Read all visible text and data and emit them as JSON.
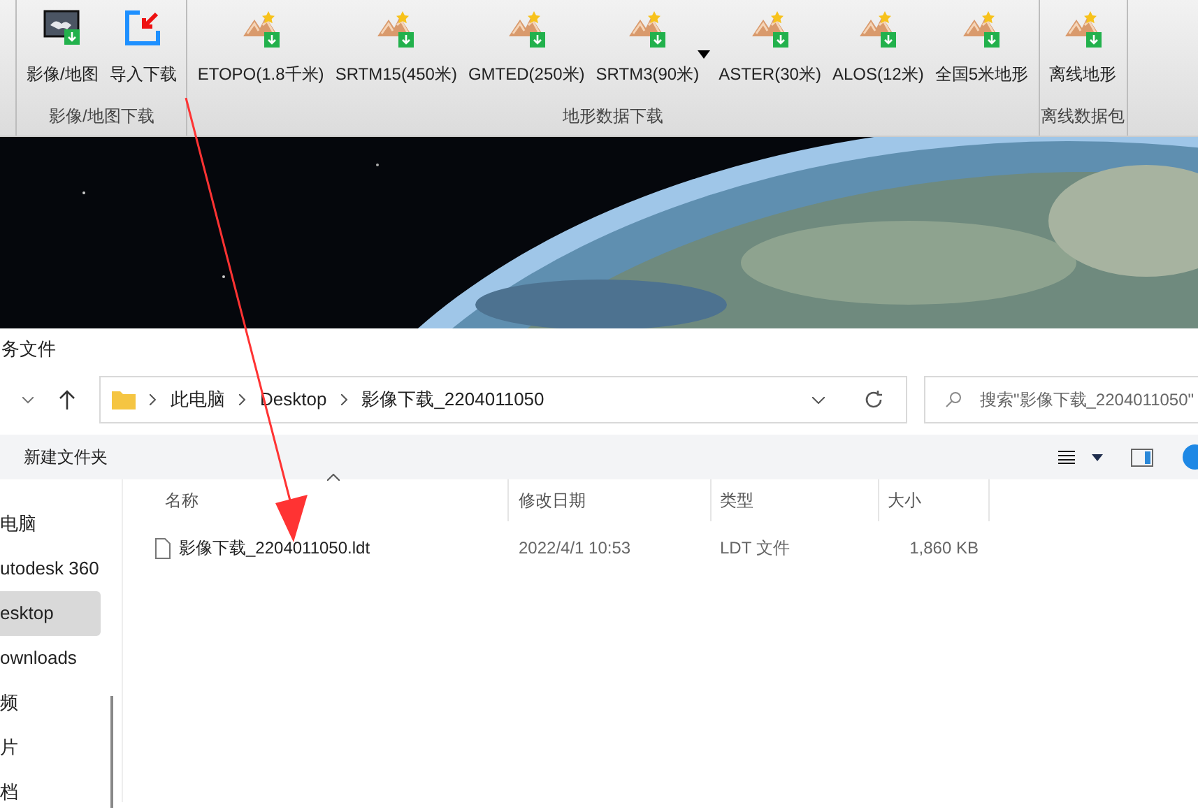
{
  "ribbon": {
    "groups": [
      {
        "label": "影像/地图下载",
        "buttons": [
          {
            "label": "影像/地图",
            "kind": "map"
          },
          {
            "label": "导入下载",
            "kind": "import"
          }
        ]
      },
      {
        "label": "地形数据下载",
        "buttons": [
          {
            "label": "ETOPO(1.8千米)",
            "kind": "terrain"
          },
          {
            "label": "SRTM15(450米)",
            "kind": "terrain"
          },
          {
            "label": "GMTED(250米)",
            "kind": "terrain"
          },
          {
            "label": "SRTM3(90米)",
            "kind": "terrain",
            "dropdown": true
          },
          {
            "label": "ASTER(30米)",
            "kind": "terrain"
          },
          {
            "label": "ALOS(12米)",
            "kind": "terrain"
          },
          {
            "label": "全国5米地形",
            "kind": "terrain"
          }
        ]
      },
      {
        "label": "离线数据包",
        "buttons": [
          {
            "label": "离线地形",
            "kind": "terrain"
          }
        ]
      }
    ]
  },
  "dialog": {
    "title": "务文件",
    "breadcrumb": [
      "此电脑",
      "Desktop",
      "影像下载_2204011050"
    ],
    "search": {
      "placeholder": "搜索\"影像下载_2204011050\""
    },
    "toolbar": {
      "new_folder": "新建文件夹"
    },
    "sidebar": [
      {
        "label": "电脑",
        "selected": false
      },
      {
        "label": "utodesk 360",
        "selected": false
      },
      {
        "label": "esktop",
        "selected": true
      },
      {
        "label": "ownloads",
        "selected": false
      },
      {
        "label": "频",
        "selected": false
      },
      {
        "label": "片",
        "selected": false
      },
      {
        "label": "档",
        "selected": false
      }
    ],
    "columns": [
      "名称",
      "修改日期",
      "类型",
      "大小"
    ],
    "rows": [
      {
        "name": "影像下载_2204011050.ldt",
        "date": "2022/4/1 10:53",
        "type": "LDT 文件",
        "size": "1,860 KB"
      }
    ]
  }
}
